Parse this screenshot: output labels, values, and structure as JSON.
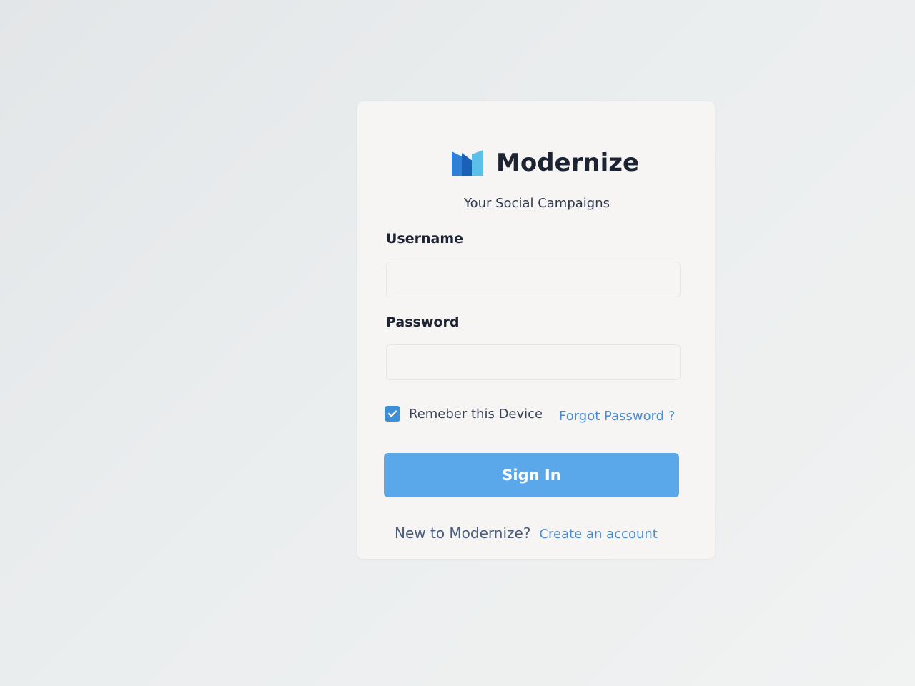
{
  "brand": {
    "name": "Modernize",
    "tagline": "Your Social Campaigns",
    "logo_icon": "modernize-logo-icon",
    "accent_color": "#3e8fd8"
  },
  "form": {
    "username_label": "Username",
    "username_value": "",
    "password_label": "Password",
    "password_value": "",
    "remember_label": "Remeber this Device",
    "remember_checked": true,
    "forgot_label": "Forgot Password ?",
    "signin_label": "Sign In"
  },
  "footer": {
    "prompt": "New to Modernize?",
    "link_label": "Create an account"
  }
}
